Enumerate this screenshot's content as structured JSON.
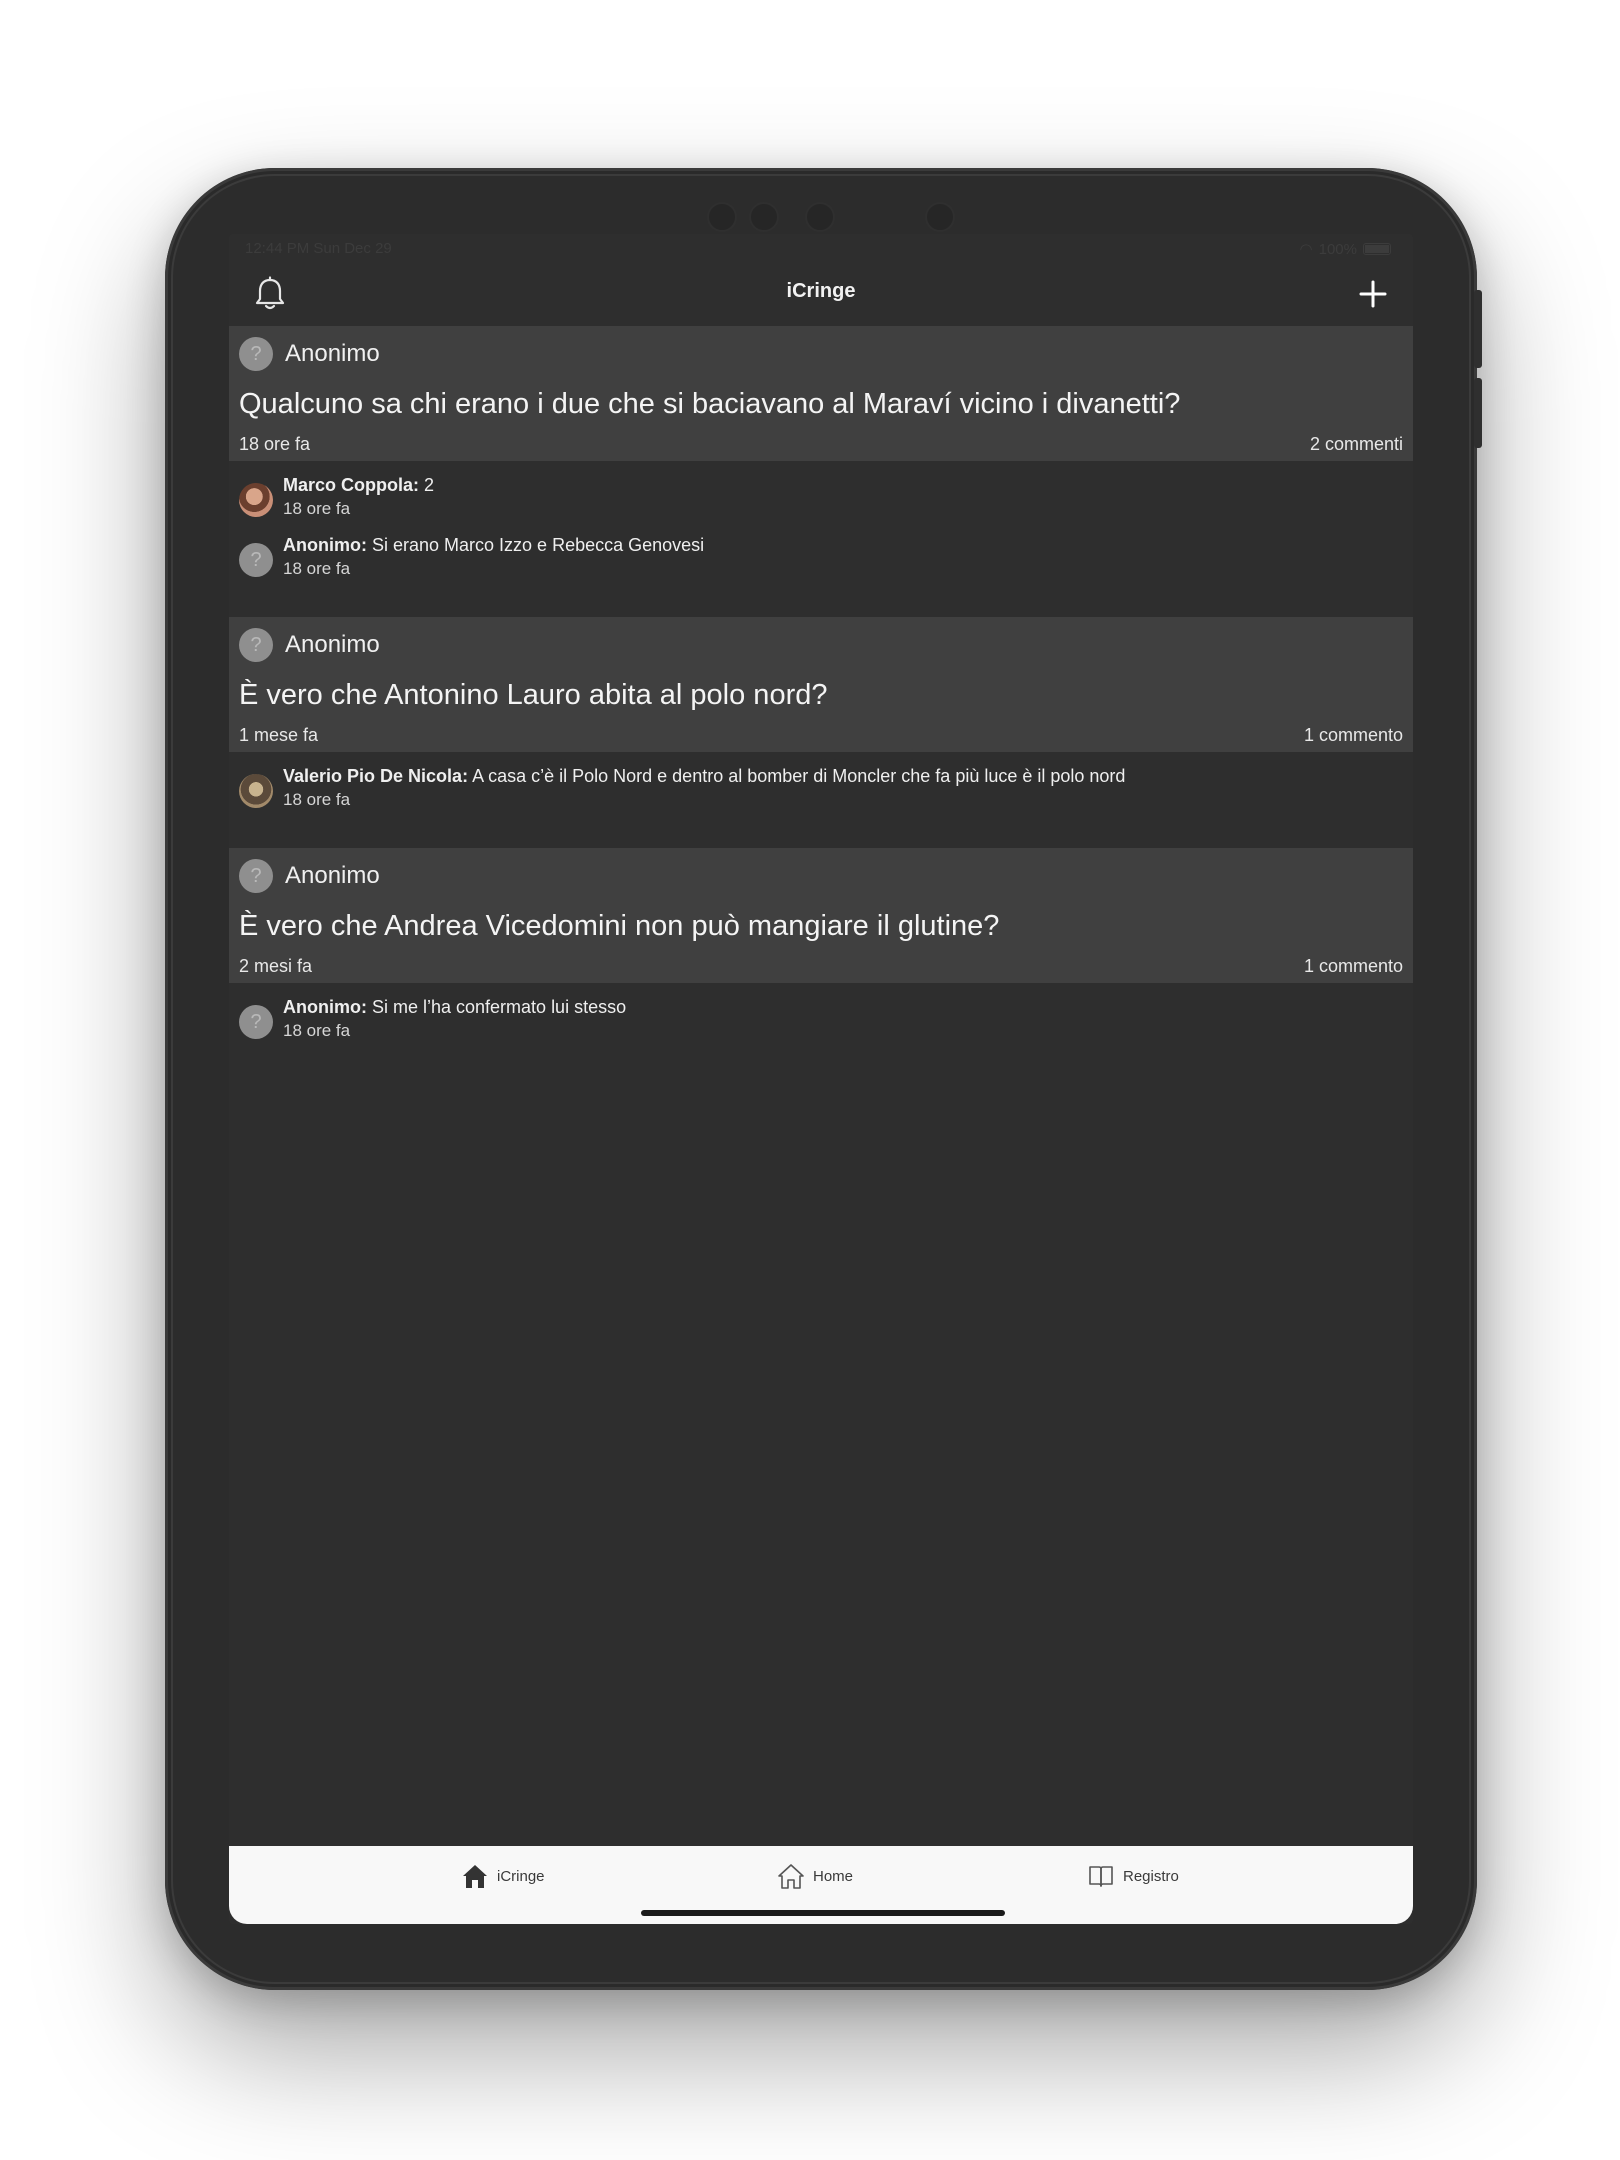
{
  "status_bar": {
    "time": "12:44 PM  Sun Dec 29",
    "battery": "100%"
  },
  "navbar": {
    "title": "iCringe",
    "left_icon": "bell-icon",
    "right_icon": "plus-icon"
  },
  "posts": [
    {
      "author": "Anonimo",
      "question": "Qualcuno sa chi erano i due che si baciavano al Maraví vicino i divanetti?",
      "time": "18 ore fa",
      "comment_count": "2 commenti",
      "comments": [
        {
          "user": "Marco Coppola:",
          "text": " 2",
          "time": "18 ore fa",
          "avatar": "photo"
        },
        {
          "user": "Anonimo:",
          "text": " Si erano Marco Izzo e Rebecca Genovesi",
          "time": "18 ore fa",
          "avatar": "anon"
        }
      ]
    },
    {
      "author": "Anonimo",
      "question": "È vero che Antonino Lauro abita al polo nord?",
      "time": "1 mese fa",
      "comment_count": "1 commento",
      "comments": [
        {
          "user": "Valerio Pio De Nicola:",
          "text": " A casa c’è il Polo Nord e dentro al bomber di Moncler che fa più luce è il polo nord",
          "time": "18 ore fa",
          "avatar": "photo"
        }
      ]
    },
    {
      "author": "Anonimo",
      "question": "È vero che Andrea Vicedomini non può mangiare il glutine?",
      "time": "2 mesi fa",
      "comment_count": "1 commento",
      "comments": [
        {
          "user": "Anonimo:",
          "text": " Si me l’ha confermato lui stesso",
          "time": "18 ore fa",
          "avatar": "anon"
        }
      ]
    }
  ],
  "anon_glyph": "?",
  "tabbar": {
    "tabs": [
      {
        "label": "iCringe",
        "icon": "house-filled-icon"
      },
      {
        "label": "Home",
        "icon": "house-outline-icon"
      },
      {
        "label": "Registro",
        "icon": "book-icon"
      }
    ]
  }
}
